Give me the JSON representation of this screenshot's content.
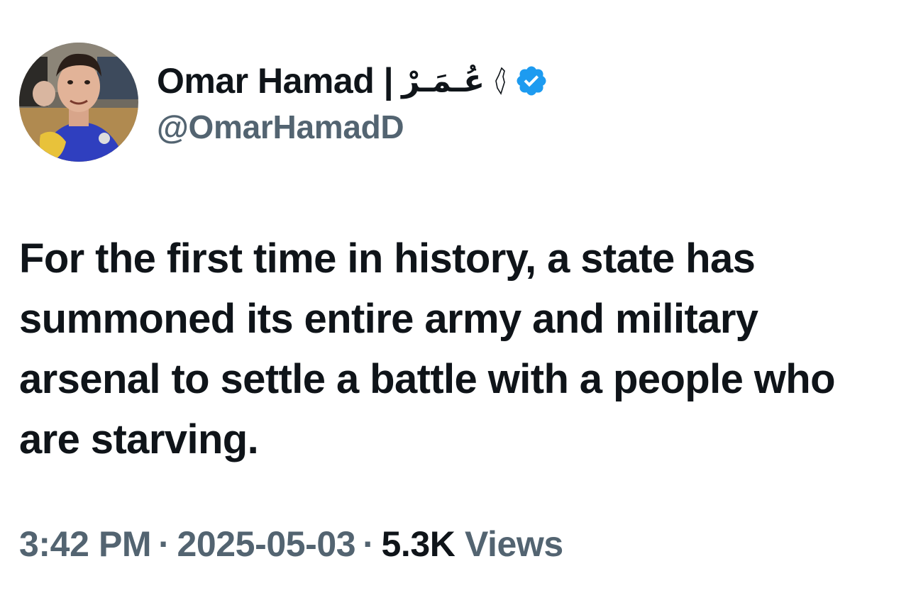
{
  "author": {
    "display_name": "Omar Hamad |",
    "arabic_name": "عُـمَـرْ",
    "handle": "@OmarHamadD",
    "verified": true,
    "avatar_icon": "profile-photo",
    "verified_icon": "verified-badge-icon",
    "flag_icon": "palestine-map-icon"
  },
  "tweet": {
    "text": "For the first time in history, a state has summoned its entire army and military arsenal to settle a battle with a people who are starving."
  },
  "meta": {
    "time": "3:42 PM",
    "separator": "·",
    "date": "2025-05-03",
    "views_count": "5.3K",
    "views_label": "Views"
  },
  "colors": {
    "primary_text": "#0f1419",
    "secondary_text": "#536471",
    "verified_blue": "#1d9bf0",
    "background": "#ffffff"
  }
}
